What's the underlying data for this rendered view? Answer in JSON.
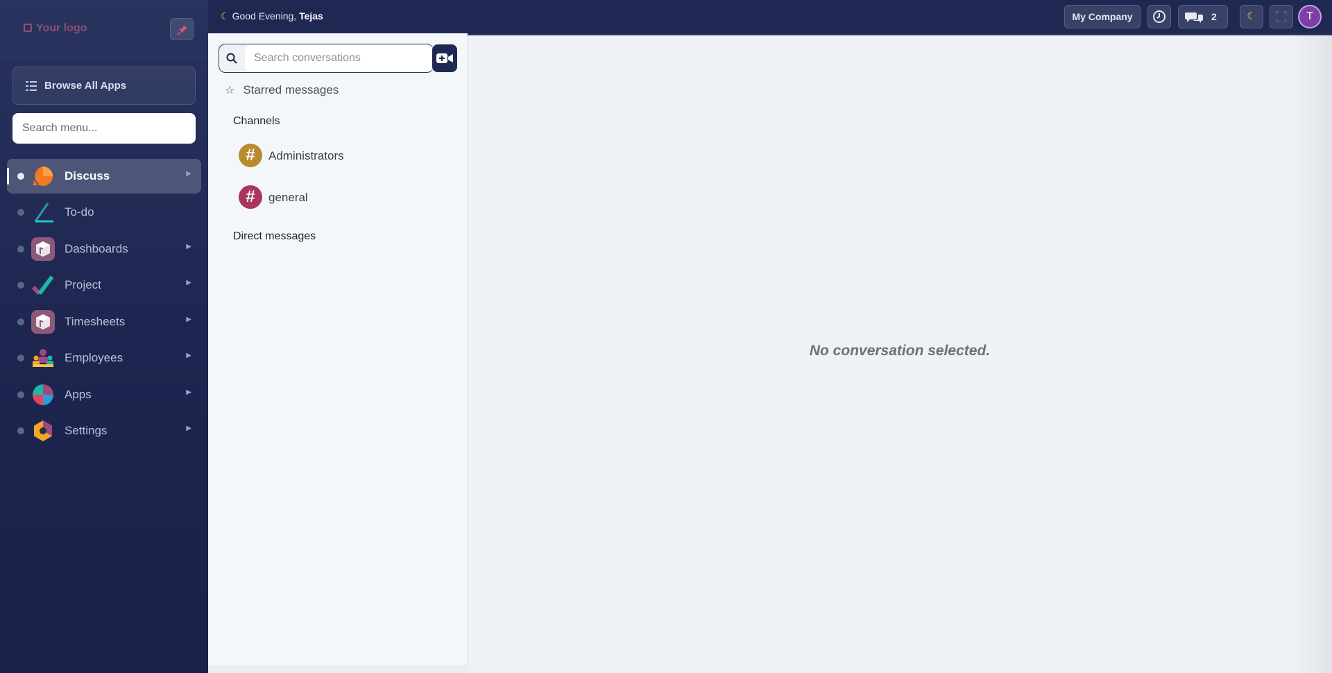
{
  "sidebar": {
    "logo": "Your logo",
    "browse_label": "Browse All Apps",
    "search_placeholder": "Search menu...",
    "items": [
      {
        "label": "Discuss",
        "icon": "discuss-icon",
        "active": true
      },
      {
        "label": "To-do",
        "icon": "todo-icon"
      },
      {
        "label": "Dashboards",
        "icon": "dashboards-icon"
      },
      {
        "label": "Project",
        "icon": "project-icon"
      },
      {
        "label": "Timesheets",
        "icon": "timesheets-icon"
      },
      {
        "label": "Employees",
        "icon": "employees-icon"
      },
      {
        "label": "Apps",
        "icon": "apps-icon"
      },
      {
        "label": "Settings",
        "icon": "settings-icon"
      }
    ]
  },
  "topbar": {
    "greeting": "Good Evening, ",
    "user_name": "Tejas",
    "company": "My Company",
    "message_count": "2",
    "avatar_initial": "T"
  },
  "discuss": {
    "search_placeholder": "Search conversations",
    "starred_label": "Starred messages",
    "channels_heading": "Channels",
    "channels": [
      {
        "name": "Administrators",
        "color": "#b98b2f"
      },
      {
        "name": "general",
        "color": "#a8365f"
      }
    ],
    "direct_heading": "Direct messages"
  },
  "main": {
    "empty_message": "No conversation selected."
  },
  "colors": {
    "sidebar_bg": "#1d2650",
    "topbar_bg": "#1f2753",
    "avatar_bg": "#7b3fa6"
  }
}
